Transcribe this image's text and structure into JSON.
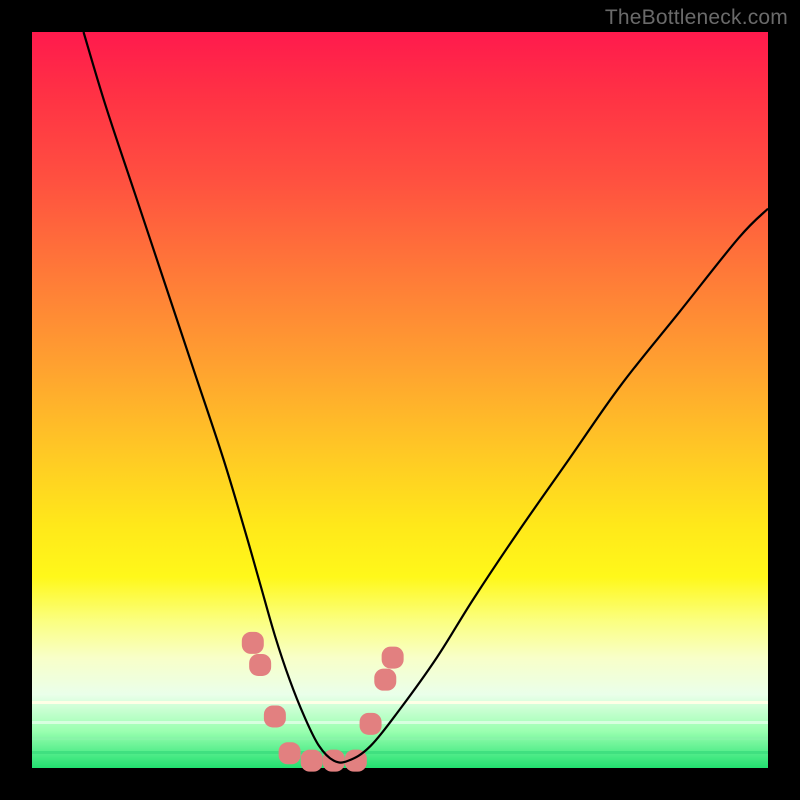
{
  "watermark": "TheBottleneck.com",
  "chart_data": {
    "type": "line",
    "title": "",
    "xlabel": "",
    "ylabel": "",
    "xlim": [
      0,
      100
    ],
    "ylim": [
      0,
      100
    ],
    "axes_visible": false,
    "grid": false,
    "background_gradient": {
      "direction": "vertical",
      "stops": [
        {
          "pos": 0,
          "color": "#ff1a4d"
        },
        {
          "pos": 33,
          "color": "#ff7a38"
        },
        {
          "pos": 67,
          "color": "#ffe81a"
        },
        {
          "pos": 90,
          "color": "#eaffea"
        },
        {
          "pos": 100,
          "color": "#22e070"
        }
      ]
    },
    "series": [
      {
        "name": "bottleneck-curve",
        "stroke": "#000000",
        "x": [
          7,
          10,
          14,
          18,
          22,
          26,
          29,
          31,
          33,
          35,
          37,
          39,
          41,
          43,
          46,
          50,
          55,
          60,
          66,
          73,
          80,
          88,
          96,
          100
        ],
        "values": [
          100,
          90,
          78,
          66,
          54,
          42,
          32,
          25,
          18,
          12,
          7,
          3,
          1,
          1,
          3,
          8,
          15,
          23,
          32,
          42,
          52,
          62,
          72,
          76
        ]
      }
    ],
    "markers": [
      {
        "name": "left-cluster",
        "shape": "rounded",
        "color": "#e28080",
        "x": 30,
        "y": 17
      },
      {
        "name": "left-cluster",
        "shape": "rounded",
        "color": "#e28080",
        "x": 31,
        "y": 14
      },
      {
        "name": "left-cluster",
        "shape": "rounded",
        "color": "#e28080",
        "x": 33,
        "y": 7
      },
      {
        "name": "floor-cluster",
        "shape": "rounded",
        "color": "#e28080",
        "x": 35,
        "y": 2
      },
      {
        "name": "floor-cluster",
        "shape": "rounded",
        "color": "#e28080",
        "x": 38,
        "y": 1
      },
      {
        "name": "floor-cluster",
        "shape": "rounded",
        "color": "#e28080",
        "x": 41,
        "y": 1
      },
      {
        "name": "floor-cluster",
        "shape": "rounded",
        "color": "#e28080",
        "x": 44,
        "y": 1
      },
      {
        "name": "right-cluster",
        "shape": "rounded",
        "color": "#e28080",
        "x": 46,
        "y": 6
      },
      {
        "name": "right-cluster",
        "shape": "rounded",
        "color": "#e28080",
        "x": 48,
        "y": 12
      },
      {
        "name": "right-cluster",
        "shape": "rounded",
        "color": "#e28080",
        "x": 49,
        "y": 15
      }
    ]
  }
}
